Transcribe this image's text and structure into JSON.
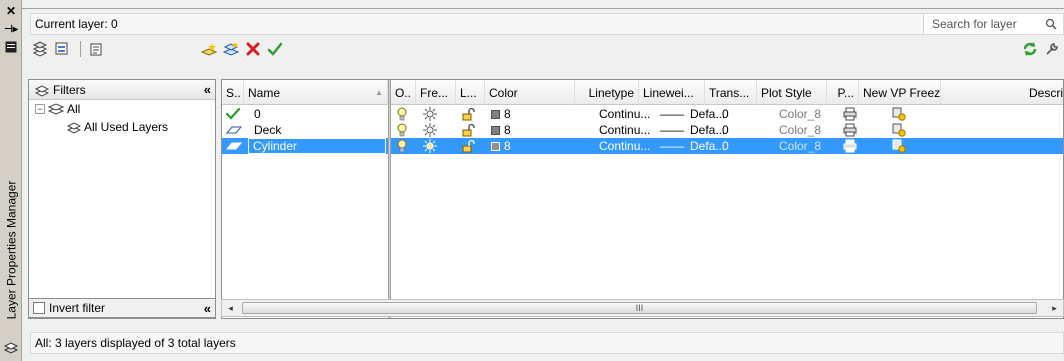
{
  "panel": {
    "title": "Layer Properties Manager",
    "current_layer": "Current layer: 0",
    "search_placeholder": "Search for layer",
    "status": "All: 3 layers displayed of 3 total layers"
  },
  "filters": {
    "header": "Filters",
    "tree": [
      {
        "label": "All"
      },
      {
        "label": "All Used Layers"
      }
    ],
    "invert_label": "Invert filter"
  },
  "grid": {
    "columns": [
      "S..",
      "Name",
      "O..",
      "Fre...",
      "L...",
      "Color",
      "Linetype",
      "Linewei...",
      "Trans...",
      "Plot Style",
      "P...",
      "New VP Freeze",
      "Descri"
    ],
    "rows": [
      {
        "name": "0",
        "color": "8",
        "linetype": "Continu...",
        "lineweight": "Defa...",
        "transparency": "0",
        "plot_style": "Color_8",
        "current": true,
        "selected": false
      },
      {
        "name": "Deck",
        "color": "8",
        "linetype": "Continu...",
        "lineweight": "Defa...",
        "transparency": "0",
        "plot_style": "Color_8",
        "current": false,
        "selected": false
      },
      {
        "name": "Cylinder",
        "color": "8",
        "linetype": "Continu...",
        "lineweight": "Defa...",
        "transparency": "0",
        "plot_style": "Color_8",
        "current": false,
        "selected": true
      }
    ],
    "lineweight_dash": "——",
    "scroll_grip": "III"
  },
  "colors": {
    "selection": "#3399ff",
    "checkmark": "#2e9e2e",
    "delete_x": "#d42020",
    "bulb": "#e8c400"
  }
}
